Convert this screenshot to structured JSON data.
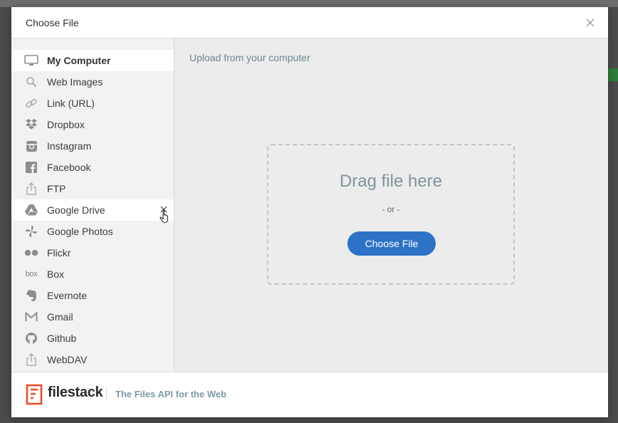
{
  "modal": {
    "title": "Choose File"
  },
  "sidebar": {
    "items": [
      {
        "label": "My Computer",
        "icon": "monitor-icon"
      },
      {
        "label": "Web Images",
        "icon": "magnifier-icon"
      },
      {
        "label": "Link (URL)",
        "icon": "link-icon"
      },
      {
        "label": "Dropbox",
        "icon": "dropbox-icon"
      },
      {
        "label": "Instagram",
        "icon": "instagram-icon"
      },
      {
        "label": "Facebook",
        "icon": "facebook-icon"
      },
      {
        "label": "FTP",
        "icon": "upload-icon"
      },
      {
        "label": "Google Drive",
        "icon": "google-drive-icon"
      },
      {
        "label": "Google Photos",
        "icon": "google-photos-icon"
      },
      {
        "label": "Flickr",
        "icon": "flickr-icon"
      },
      {
        "label": "Box",
        "icon": "box-icon",
        "icon_text": "box"
      },
      {
        "label": "Evernote",
        "icon": "evernote-icon"
      },
      {
        "label": "Gmail",
        "icon": "gmail-icon"
      },
      {
        "label": "Github",
        "icon": "github-icon"
      },
      {
        "label": "WebDAV",
        "icon": "upload-icon"
      }
    ]
  },
  "main": {
    "heading": "Upload from your computer",
    "dropzone": {
      "drag_text": "Drag file here",
      "or_text": "- or -",
      "button_label": "Choose File"
    }
  },
  "footer": {
    "brand": "filestack",
    "tagline": "The Files API for the Web"
  },
  "colors": {
    "accent": "#2e72c7",
    "brand_red": "#ef4a25",
    "sidebar_bg": "#f2f2f2",
    "main_bg": "#ececec"
  }
}
